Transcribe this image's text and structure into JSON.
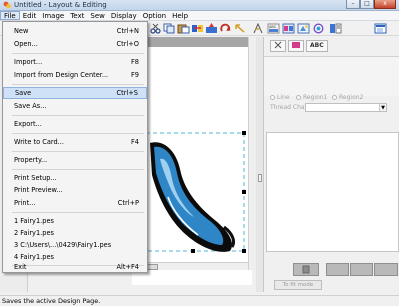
{
  "window": {
    "title": "Untitled - Layout & Editing",
    "minimize_label": "–",
    "maximize_label": "□",
    "close_label": "x"
  },
  "menubar": [
    "File",
    "Edit",
    "Image",
    "Text",
    "Sew",
    "Display",
    "Option",
    "Help"
  ],
  "file_menu": {
    "items": [
      {
        "label": "New",
        "shortcut": "Ctrl+N"
      },
      {
        "label": "Open...",
        "shortcut": "Ctrl+O"
      },
      {
        "label": "Import...",
        "shortcut": "F8"
      },
      {
        "label": "Import from Design Center...",
        "shortcut": "F9"
      },
      {
        "label": "Save",
        "shortcut": "Ctrl+S"
      },
      {
        "label": "Save As...",
        "shortcut": ""
      },
      {
        "label": "Export...",
        "shortcut": ""
      },
      {
        "label": "Write to Card...",
        "shortcut": "F4"
      },
      {
        "label": "Property...",
        "shortcut": ""
      },
      {
        "label": "Print Setup...",
        "shortcut": ""
      },
      {
        "label": "Print Preview...",
        "shortcut": ""
      },
      {
        "label": "Print...",
        "shortcut": "Ctrl+P"
      },
      {
        "label": "1 Fairy1.pes",
        "shortcut": ""
      },
      {
        "label": "2 Fairy1.pes",
        "shortcut": ""
      },
      {
        "label": "3 C:\\Users\\...\\0429\\Fairy1.pes",
        "shortcut": ""
      },
      {
        "label": "4 Fairy1.pes",
        "shortcut": ""
      },
      {
        "label": "Exit",
        "shortcut": "Alt+F4"
      }
    ],
    "highlighted": "Save"
  },
  "panel": {
    "tab_abc": "ABC",
    "radio_line": "Line",
    "radio_region1": "Region1",
    "radio_region2": "Region2",
    "thread_chart_label": "Thread Chart",
    "fit_mode_button": "To fit mode"
  },
  "scroll": {
    "thumb_label": "|||"
  },
  "status": "Saves the active Design Page.",
  "colors": {
    "menu_highlight": "#cfe1f6",
    "design_blue": "#2f86c6",
    "selection_dash": "#4fb7d9"
  },
  "icons": [
    "app-icon",
    "open-icon",
    "cut-icon",
    "copy-icon",
    "paste-icon",
    "sew-icon",
    "transfer-icon",
    "rotate-icon",
    "select-icon",
    "text-icon",
    "color-icon",
    "pattern-icon",
    "view-icon",
    "chart-icon",
    "layout-icon"
  ]
}
